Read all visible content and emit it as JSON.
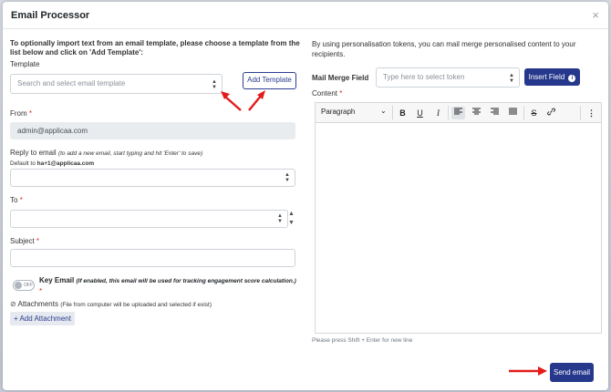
{
  "modal": {
    "title": "Email Processor",
    "close": "×"
  },
  "template": {
    "instruction": "To optionally import text from an email template, please choose a template from the list below and click on 'Add Template':",
    "label": "Template",
    "placeholder": "Search and select email template",
    "add_button": "Add Template"
  },
  "from": {
    "label": "From",
    "required": "*",
    "value": "admin@applicaa.com"
  },
  "reply": {
    "label": "Reply to email",
    "hint": "(to add a new email, start typing and hit 'Enter' to save)",
    "default_prefix": "Default to",
    "default_value": "ha+1@applicaa.com"
  },
  "to": {
    "label": "To",
    "required": "*"
  },
  "subject": {
    "label": "Subject",
    "required": "*"
  },
  "key_email": {
    "toggle_state": "OFF",
    "label": "Key Email",
    "hint": "(If enabled, this email will be used for tracking engagement score calculation.)",
    "required": "*"
  },
  "attachments": {
    "label": "Attachments",
    "hint": "(File from computer will be uploaded and selected if exist)",
    "add_button": "+ Add Attachment"
  },
  "right": {
    "intro": "By using personalisation tokens, you can mail merge personalised content to your recipients.",
    "merge_label": "Mail Merge Field",
    "merge_placeholder": "Type here to select token",
    "insert_button": "Insert Field",
    "content_label": "Content",
    "content_required": "*",
    "paragraph": "Paragraph",
    "hint": "Please press Shift + Enter for new line",
    "send_button": "Send email"
  },
  "colors": {
    "primary": "#26388c",
    "arrow": "#e31b1b",
    "required": "#d93025"
  },
  "icons": [
    "close-icon",
    "updown-arrows-icon",
    "bold-icon",
    "underline-icon",
    "italic-icon",
    "align-left-icon",
    "align-center-icon",
    "align-right-icon",
    "justify-icon",
    "strikethrough-icon",
    "link-icon",
    "more-icon",
    "info-icon",
    "paperclip-icon",
    "red-arrow"
  ]
}
